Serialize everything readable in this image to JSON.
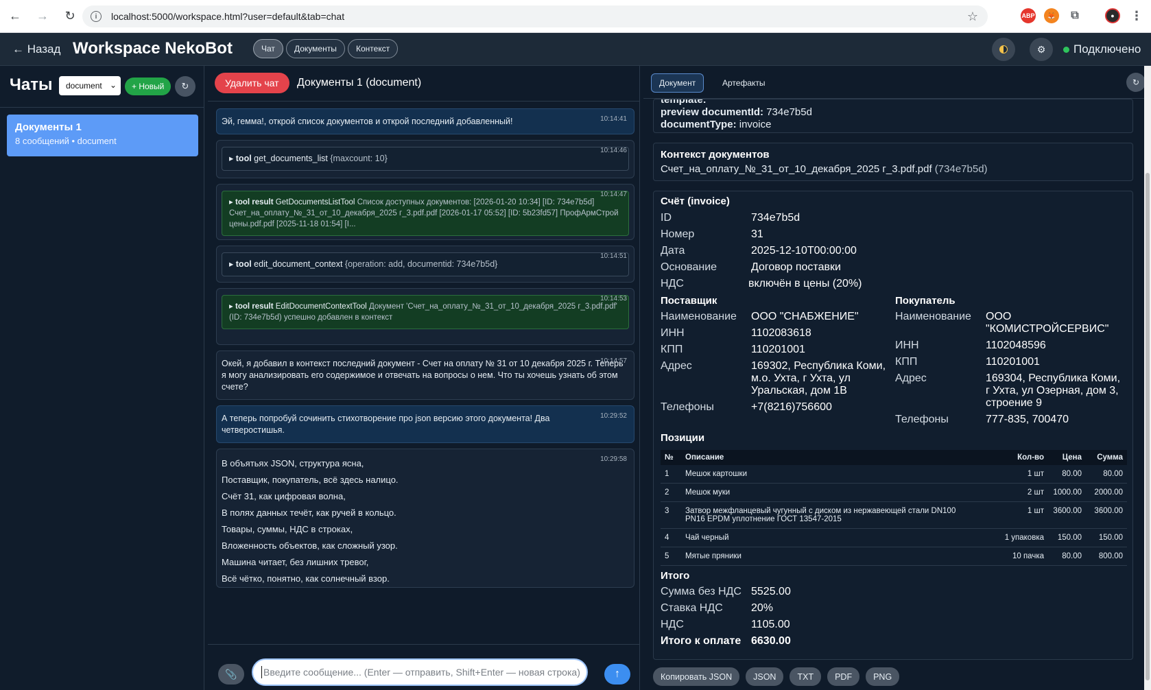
{
  "browser": {
    "url": "localhost:5000/workspace.html?user=default&tab=chat"
  },
  "header": {
    "back_label": "← Назад",
    "title": "Workspace NekoBot",
    "tabs": [
      {
        "label": "Чат",
        "active": true
      },
      {
        "label": "Документы",
        "active": false
      },
      {
        "label": "Контекст",
        "active": false
      }
    ],
    "status_label": "Подключено",
    "status_color": "#2fc45c"
  },
  "sidebar": {
    "title": "Чаты",
    "filter_value": "document",
    "new_label": "+ Новый",
    "chats": [
      {
        "title": "Документы 1",
        "subtitle": "8 сообщений • document"
      }
    ]
  },
  "chat": {
    "delete_label": "Удалить чат",
    "title": "Документы 1 (document)",
    "messages": [
      {
        "time": "10:14:41",
        "text": "Эй, гемма!, открой список документов и открой последний добавленный!"
      },
      {
        "time": "10:14:46",
        "tool_kind": "tool",
        "tool_name": "get_documents_list",
        "tool_args": "{maxcount: 10}"
      },
      {
        "time": "10:14:47",
        "tool_kind": "tool result",
        "tool_name": "GetDocumentsListTool",
        "tool_args": "Список доступных документов: [2026-01-20 10:34] [ID: 734e7b5d] Счет_на_оплату_№_31_от_10_декабря_2025 г_3.pdf.pdf [2026-01-17 05:52] [ID: 5b23fd57] ПрофАрмСтрой цены.pdf.pdf [2025-11-18 01:54] [I..."
      },
      {
        "time": "10:14:51",
        "tool_kind": "tool",
        "tool_name": "edit_document_context",
        "tool_args": "{operation: add, documentid: 734e7b5d}"
      },
      {
        "time": "10:14:53",
        "tool_kind": "tool result",
        "tool_name": "EditDocumentContextTool",
        "tool_args": "Документ 'Счет_на_оплату_№_31_от_10_декабря_2025 г_3.pdf.pdf' (ID: 734e7b5d) успешно добавлен в контекст"
      },
      {
        "time": "10:14:57",
        "text": "Окей, я добавил в контекст последний документ - Счет на оплату № 31 от 10 декабря 2025 г. Теперь я могу анализировать его содержимое и отвечать на вопросы о нем. Что ты хочешь узнать об этом счете?"
      },
      {
        "time": "10:29:52",
        "text": "А теперь попробуй сочинить стихотворение про json версию этого документа! Два четверостишья."
      },
      {
        "time": "10:29:58",
        "lines": [
          "В объятьях JSON, структура ясна,",
          "Поставщик, покупатель, всё здесь налицо.",
          "Счёт 31, как цифровая волна,",
          "В полях данных течёт, как ручей в кольцо.",
          "Товары, суммы, НДС в строках,",
          "Вложенность объектов, как сложный узор.",
          "Машина читает, без лишних тревог,",
          "Всё чётко, понятно, как солнечный взор."
        ]
      }
    ],
    "input_placeholder": "Введите сообщение... (Enter — отправить, Shift+Enter — новая строка)"
  },
  "doc": {
    "tabs": [
      {
        "label": "Документ",
        "active": true
      },
      {
        "label": "Артефакты",
        "active": false
      }
    ],
    "preview": {
      "cut_label": "template:",
      "doc_id_label": "preview documentId:",
      "doc_id": "734e7b5d",
      "doc_type_label": "documentType:",
      "doc_type": "invoice"
    },
    "context": {
      "title": "Контекст документов",
      "file": "Счет_на_оплату_№_31_от_10_декабря_2025 г_3.pdf.pdf",
      "id": "(734e7b5d)"
    },
    "invoice": {
      "title": "Счёт (invoice)",
      "fields": [
        {
          "k": "ID",
          "v": "734e7b5d"
        },
        {
          "k": "Номер",
          "v": "31"
        },
        {
          "k": "Дата",
          "v": "2025-12-10T00:00:00"
        },
        {
          "k": "Основание",
          "v": "Договор поставки"
        },
        {
          "k": "НДС",
          "v": "включён в цены (20%)"
        }
      ],
      "supplier": {
        "title": "Поставщик",
        "fields": [
          {
            "k": "Наименование",
            "v": "ООО \"СНАБЖЕНИЕ\""
          },
          {
            "k": "ИНН",
            "v": "1102083618"
          },
          {
            "k": "КПП",
            "v": "110201001"
          },
          {
            "k": "Адрес",
            "v": "169302, Республика Коми, м.о. Ухта, г Ухта, ул Уральская, дом 1В"
          },
          {
            "k": "Телефоны",
            "v": "+7(8216)756600"
          }
        ]
      },
      "buyer": {
        "title": "Покупатель",
        "fields": [
          {
            "k": "Наименование",
            "v": "ООО \"КОМИСТРОЙСЕРВИС\""
          },
          {
            "k": "ИНН",
            "v": "1102048596"
          },
          {
            "k": "КПП",
            "v": "110201001"
          },
          {
            "k": "Адрес",
            "v": "169304, Республика Коми, г Ухта, ул Озерная, дом 3, строение 9"
          },
          {
            "k": "Телефоны",
            "v": "777-835, 700470"
          }
        ]
      },
      "positions_title": "Позиции",
      "table_headers": [
        "№",
        "Описание",
        "Кол-во",
        "Цена",
        "Сумма"
      ],
      "rows": [
        [
          "1",
          "Мешок картошки",
          "1 шт",
          "80.00",
          "80.00"
        ],
        [
          "2",
          "Мешок муки",
          "2 шт",
          "1000.00",
          "2000.00"
        ],
        [
          "3",
          "Затвор межфланцевый чугунный с диском из нержавеющей стали DN100 PN16 EPDM уплотнение ГОСТ 13547-2015",
          "1 шт",
          "3600.00",
          "3600.00"
        ],
        [
          "4",
          "Чай черный",
          "1 упаковка",
          "150.00",
          "150.00"
        ],
        [
          "5",
          "Мятые пряники",
          "10 пачка",
          "80.00",
          "800.00"
        ]
      ],
      "totals_title": "Итого",
      "totals": [
        {
          "k": "Сумма без НДС",
          "v": "5525.00"
        },
        {
          "k": "Ставка НДС",
          "v": "20%"
        },
        {
          "k": "НДС",
          "v": "1105.00"
        },
        {
          "k": "Итого к оплате",
          "v": "6630.00"
        }
      ]
    },
    "actions": [
      "Копировать JSON",
      "JSON",
      "TXT",
      "PDF",
      "PNG"
    ]
  }
}
